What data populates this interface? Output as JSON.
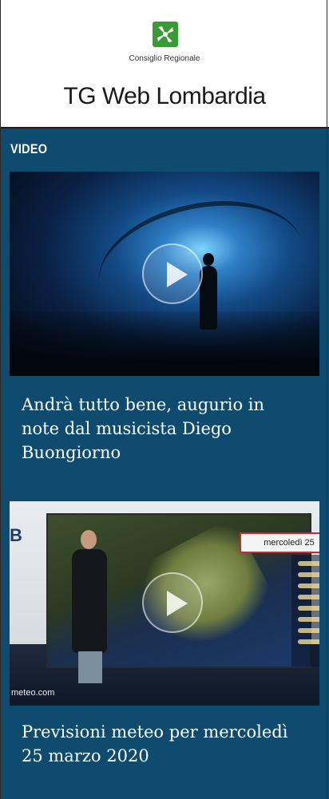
{
  "header": {
    "logo_icon": "consiglio-regionale-logo",
    "region_label": "Consiglio Regionale",
    "brand_title": "TG Web Lombardia",
    "logo_color": "#3a9a35"
  },
  "section": {
    "label": "VIDEO",
    "background": "#0f4a6f"
  },
  "videos": [
    {
      "caption": "Andrà tutto bene, augurio in note dal musicista Diego Buongiorno",
      "play_icon": "play-icon"
    },
    {
      "caption": "Previsioni meteo per mercoledì 25 marzo 2020",
      "play_icon": "play-icon",
      "overlay_date": "mercoledì 25",
      "watermark": "meteo.com",
      "sign_text": "B"
    }
  ]
}
